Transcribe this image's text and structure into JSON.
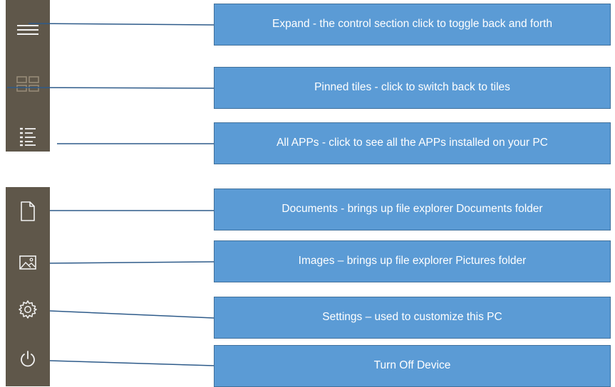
{
  "callouts": [
    {
      "id": "expand",
      "icon": "hamburger-menu-icon",
      "text": "Expand - the control section click to toggle back and forth"
    },
    {
      "id": "pinned-tiles",
      "icon": "tiles-icon",
      "text": "Pinned tiles - click to switch back to tiles"
    },
    {
      "id": "all-apps",
      "icon": "list-icon",
      "text": "All APPs - click to see all the APPs installed on your PC"
    },
    {
      "id": "documents",
      "icon": "document-icon",
      "text": "Documents - brings up file explorer Documents folder"
    },
    {
      "id": "images",
      "icon": "image-icon",
      "text": "Images – brings up file explorer Pictures folder"
    },
    {
      "id": "settings",
      "icon": "gear-icon",
      "text": "Settings – used to customize this PC"
    },
    {
      "id": "power",
      "icon": "power-icon",
      "text": "Turn Off Device"
    }
  ],
  "colors": {
    "rail": "#5f574a",
    "icon_stroke": "#f2f2f2",
    "tiles_icon_stroke": "#9a8e7a",
    "callout_fill": "#5b9bd5",
    "callout_border": "#41719c",
    "leader_line": "#2e5b8a"
  }
}
